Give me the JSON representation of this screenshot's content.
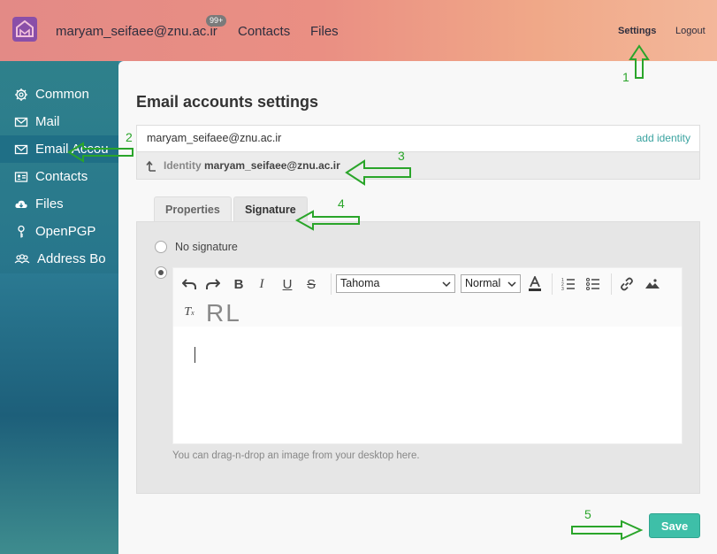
{
  "header": {
    "user_email": "maryam_seifaee@znu.ac.ir",
    "badge": "99+",
    "contacts": "Contacts",
    "files": "Files",
    "settings": "Settings",
    "logout": "Logout",
    "logo_icon": "house-envelope-icon"
  },
  "sidebar": {
    "items": [
      {
        "label": "Common",
        "icon": "gear-icon"
      },
      {
        "label": "Mail",
        "icon": "envelope-icon"
      },
      {
        "label": "Email Accou",
        "icon": "envelope-icon",
        "active": true
      },
      {
        "label": "Contacts",
        "icon": "contact-card-icon"
      },
      {
        "label": "Files",
        "icon": "cloud-download-icon"
      },
      {
        "label": "OpenPGP",
        "icon": "key-icon"
      },
      {
        "label": "Address Bo",
        "icon": "group-icon"
      }
    ]
  },
  "main": {
    "title": "Email accounts settings",
    "account_email": "maryam_seifaee@znu.ac.ir",
    "add_identity": "add identity",
    "identity_prefix": "Identity",
    "identity_name": "maryam_seifaee@znu.ac.ir",
    "tabs": [
      {
        "label": "Properties",
        "active": false
      },
      {
        "label": "Signature",
        "active": true
      }
    ],
    "no_signature": "No signature",
    "editor": {
      "font": "Tahoma",
      "size": "Normal",
      "rl": "RL",
      "drag_hint": "You can drag-n-drop an image from your desktop here."
    },
    "save": "Save"
  },
  "annotations": [
    "1",
    "2",
    "3",
    "4",
    "5"
  ],
  "colors": {
    "accent": "#3ebfa8",
    "annotation": "#2aa52a",
    "link": "#3aa3a0"
  }
}
